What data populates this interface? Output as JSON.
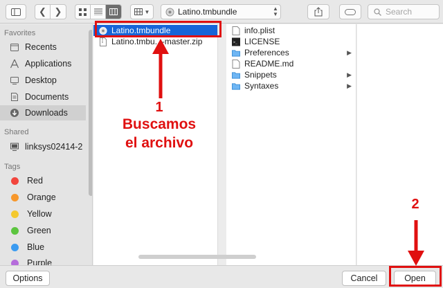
{
  "toolbar": {
    "path_label": "Latino.tmbundle",
    "search_placeholder": "Search"
  },
  "sidebar": {
    "favorites_heading": "Favorites",
    "favorites": [
      {
        "label": "Recents",
        "icon": "recents-icon"
      },
      {
        "label": "Applications",
        "icon": "applications-icon"
      },
      {
        "label": "Desktop",
        "icon": "desktop-icon"
      },
      {
        "label": "Documents",
        "icon": "documents-icon"
      },
      {
        "label": "Downloads",
        "icon": "downloads-icon"
      }
    ],
    "shared_heading": "Shared",
    "shared": [
      {
        "label": "linksys02414-2",
        "icon": "network-computer-icon"
      }
    ],
    "tags_heading": "Tags",
    "tags": [
      {
        "label": "Red",
        "color": "#f2453d"
      },
      {
        "label": "Orange",
        "color": "#f7972b"
      },
      {
        "label": "Yellow",
        "color": "#f4c92e"
      },
      {
        "label": "Green",
        "color": "#5cc53f"
      },
      {
        "label": "Blue",
        "color": "#3b9bf1"
      },
      {
        "label": "Purple",
        "color": "#b56ddb"
      }
    ]
  },
  "column1": {
    "items": [
      {
        "label": "Latino.tmbundle",
        "selected": true
      },
      {
        "label": "Latino.tmbu...-master.zip",
        "selected": false
      }
    ]
  },
  "column2": {
    "items": [
      {
        "label": "info.plist",
        "kind": "file",
        "has_children": false
      },
      {
        "label": "LICENSE",
        "kind": "terminal",
        "has_children": false
      },
      {
        "label": "Preferences",
        "kind": "folder",
        "has_children": true
      },
      {
        "label": "README.md",
        "kind": "file",
        "has_children": false
      },
      {
        "label": "Snippets",
        "kind": "folder",
        "has_children": true
      },
      {
        "label": "Syntaxes",
        "kind": "folder",
        "has_children": true
      }
    ]
  },
  "buttons": {
    "options": "Options",
    "cancel": "Cancel",
    "open": "Open"
  },
  "annotations": {
    "step1_number": "1",
    "step1_line1": "Buscamos",
    "step1_line2": "el archivo",
    "step2_number": "2",
    "color": "#e01010"
  }
}
